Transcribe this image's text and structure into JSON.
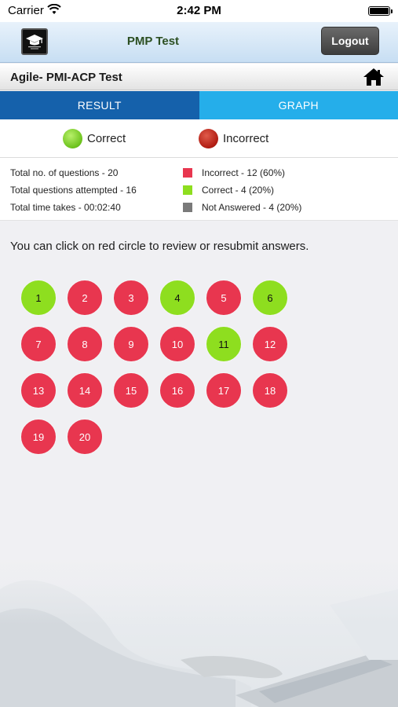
{
  "status_bar": {
    "carrier": "Carrier",
    "time": "2:42 PM"
  },
  "header": {
    "title": "PMP Test",
    "logout_label": "Logout",
    "logo_icon": "graduation-cap-icon"
  },
  "sub_header": {
    "title": "Agile- PMI-ACP Test",
    "home_icon": "home-icon"
  },
  "tabs": [
    {
      "label": "RESULT",
      "selected": true
    },
    {
      "label": "GRAPH",
      "selected": false
    }
  ],
  "legend": {
    "correct_label": "Correct",
    "incorrect_label": "Incorrect"
  },
  "stats": {
    "total_questions": "Total no. of questions - 20",
    "attempted": "Total questions attempted - 16",
    "time": "Total time takes - 00:02:40"
  },
  "breakdown": {
    "incorrect": "Incorrect - 12 (60%)",
    "correct": "Correct - 4 (20%)",
    "not_answered": "Not Answered - 4 (20%)"
  },
  "colors": {
    "incorrect": "#e8364f",
    "correct": "#8ede1f",
    "not_answered": "#7a7a7a",
    "tab_selected": "#1561ab",
    "tab_unselected": "#25aeea"
  },
  "instruction": "You can click on red circle to review or resubmit answers.",
  "questions": [
    {
      "number": "1",
      "status": "correct"
    },
    {
      "number": "2",
      "status": "incorrect"
    },
    {
      "number": "3",
      "status": "incorrect"
    },
    {
      "number": "4",
      "status": "correct"
    },
    {
      "number": "5",
      "status": "incorrect"
    },
    {
      "number": "6",
      "status": "correct"
    },
    {
      "number": "7",
      "status": "incorrect"
    },
    {
      "number": "8",
      "status": "incorrect"
    },
    {
      "number": "9",
      "status": "incorrect"
    },
    {
      "number": "10",
      "status": "incorrect"
    },
    {
      "number": "11",
      "status": "correct"
    },
    {
      "number": "12",
      "status": "incorrect"
    },
    {
      "number": "13",
      "status": "incorrect"
    },
    {
      "number": "14",
      "status": "incorrect"
    },
    {
      "number": "15",
      "status": "incorrect"
    },
    {
      "number": "16",
      "status": "incorrect"
    },
    {
      "number": "17",
      "status": "incorrect"
    },
    {
      "number": "18",
      "status": "incorrect"
    },
    {
      "number": "19",
      "status": "incorrect"
    },
    {
      "number": "20",
      "status": "incorrect"
    }
  ]
}
